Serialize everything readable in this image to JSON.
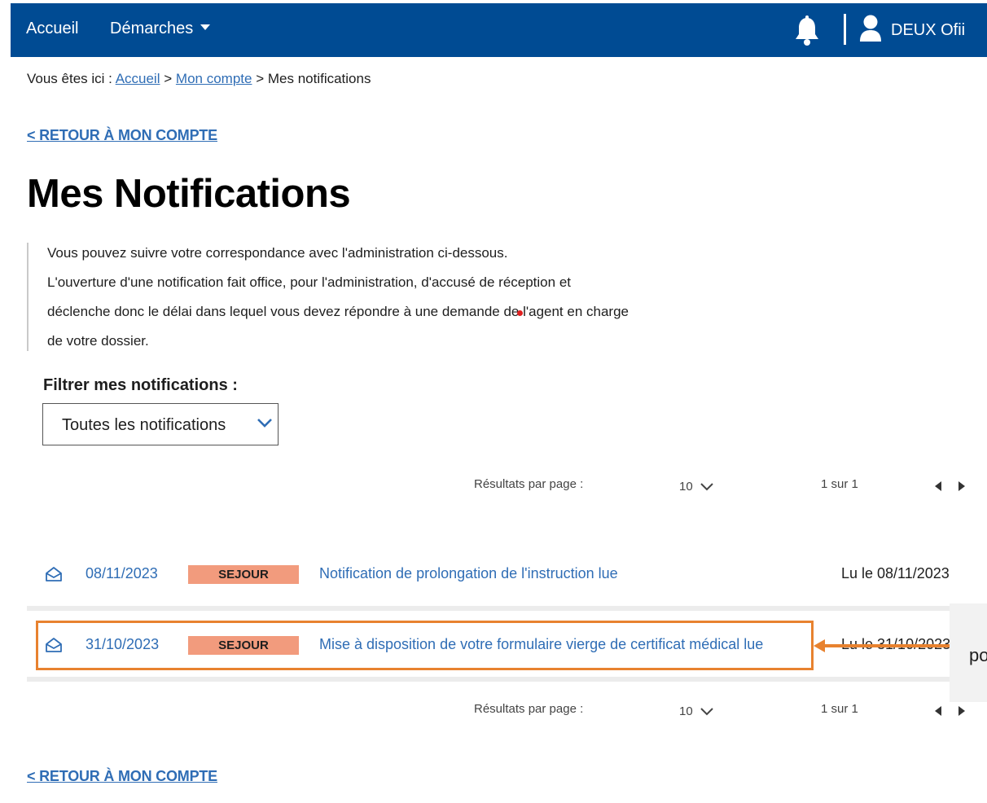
{
  "nav": {
    "home": "Accueil",
    "demarches": "Démarches",
    "user": "DEUX Ofii",
    "bell_icon": "bell-icon",
    "user_icon": "user-icon"
  },
  "breadcrumb": {
    "prefix": "Vous êtes ici :",
    "home": "Accueil",
    "sep": ">",
    "account": "Mon compte",
    "current": "Mes notifications"
  },
  "back_link": "< RETOUR À MON COMPTE",
  "title": "Mes Notifications",
  "intro": [
    "Vous pouvez suivre votre correspondance avec l'administration ci-dessous.",
    "L'ouverture d'une notification fait office, pour l'administration, d'accusé de réception et",
    "déclenche donc le délai dans lequel vous devez répondre à une demande de l'agent en charge",
    "de votre dossier."
  ],
  "filter": {
    "label": "Filtrer mes notifications :",
    "value": "Toutes les notifications"
  },
  "pager": {
    "label": "Résultats par page :",
    "value": "10",
    "info": "1 sur 1"
  },
  "notifications": [
    {
      "date": "08/11/2023",
      "category": "SEJOUR",
      "title": "Notification de prolongation de l'instruction lue",
      "read": "Lu le 08/11/2023"
    },
    {
      "date": "31/10/2023",
      "category": "SEJOUR",
      "title": "Mise à disposition de votre formulaire vierge de certificat médical lue",
      "read": "Lu le 31/10/2023"
    }
  ],
  "annotation": {
    "callout_text": "po",
    "color": "#e8822f"
  },
  "colors": {
    "nav_bg": "#004b93",
    "link": "#2f6db5",
    "badge": "#f29b7d"
  }
}
